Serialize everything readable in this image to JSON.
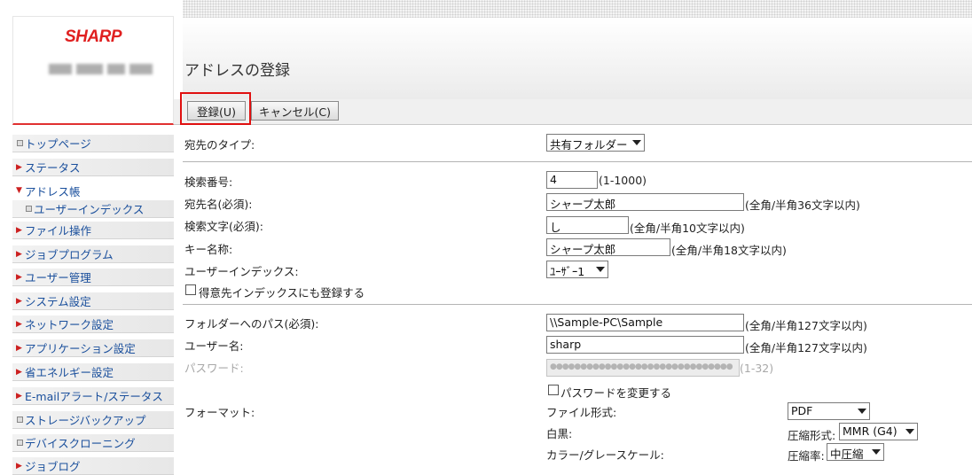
{
  "brand": {
    "logo": "SHARP"
  },
  "page": {
    "title": "アドレスの登録"
  },
  "toolbar": {
    "register_label": "登録(U)",
    "cancel_label": "キャンセル(C)"
  },
  "sidebar": {
    "items": [
      {
        "label": "トップページ",
        "marker": "square"
      },
      {
        "label": "ステータス",
        "marker": "arrow-right"
      },
      {
        "label": "アドレス帳",
        "marker": "arrow-down"
      },
      {
        "label": "ユーザーインデックス",
        "marker": "square"
      },
      {
        "label": "ファイル操作",
        "marker": "arrow-right"
      },
      {
        "label": "ジョブプログラム",
        "marker": "arrow-right"
      },
      {
        "label": "ユーザー管理",
        "marker": "arrow-right"
      },
      {
        "label": "システム設定",
        "marker": "arrow-right"
      },
      {
        "label": "ネットワーク設定",
        "marker": "arrow-right"
      },
      {
        "label": "アプリケーション設定",
        "marker": "arrow-right"
      },
      {
        "label": "省エネルギー設定",
        "marker": "arrow-right"
      },
      {
        "label": "E-mailアラート/ステータス",
        "marker": "arrow-right"
      },
      {
        "label": "ストレージバックアップ",
        "marker": "square"
      },
      {
        "label": "デバイスクローニング",
        "marker": "square"
      },
      {
        "label": "ジョブログ",
        "marker": "arrow-right"
      }
    ]
  },
  "form": {
    "dest_type": {
      "label": "宛先のタイプ:",
      "value": "共有フォルダー"
    },
    "search_no": {
      "label": "検索番号:",
      "value": "4",
      "hint": "(1-1000)"
    },
    "dest_name": {
      "label": "宛先名(必須):",
      "value": "シャープ太郎",
      "hint": "(全角/半角36文字以内)"
    },
    "search_char": {
      "label": "検索文字(必須):",
      "value": "し",
      "hint": "(全角/半角10文字以内)"
    },
    "key_name": {
      "label": "キー名称:",
      "value": "シャープ太郎",
      "hint": "(全角/半角18文字以内)"
    },
    "user_index": {
      "label": "ユーザーインデックス:",
      "value": "ﾕｰｻﾞｰ1"
    },
    "favorite": {
      "label": "得意先インデックスにも登録する"
    },
    "folder_path": {
      "label": "フォルダーへのパス(必須):",
      "value": "\\\\Sample-PC\\Sample",
      "hint": "(全角/半角127文字以内)"
    },
    "username": {
      "label": "ユーザー名:",
      "value": "sharp",
      "hint": "(全角/半角127文字以内)"
    },
    "password": {
      "label": "パスワード:",
      "value": "●●●●●●●●●●●●●●●●●●●●●●●●●●●●●●",
      "hint": "(1-32)"
    },
    "change_password": {
      "label": "パスワードを変更する"
    },
    "format": {
      "label": "フォーマット:",
      "file_type_label": "ファイル形式:",
      "file_type_value": "PDF",
      "mono_label": "白黒:",
      "compression_label": "圧縮形式:",
      "compression_value": "MMR (G4)",
      "color_label": "カラー/グレースケール:",
      "ratio_label": "圧縮率:",
      "ratio_value": "中圧縮"
    }
  }
}
